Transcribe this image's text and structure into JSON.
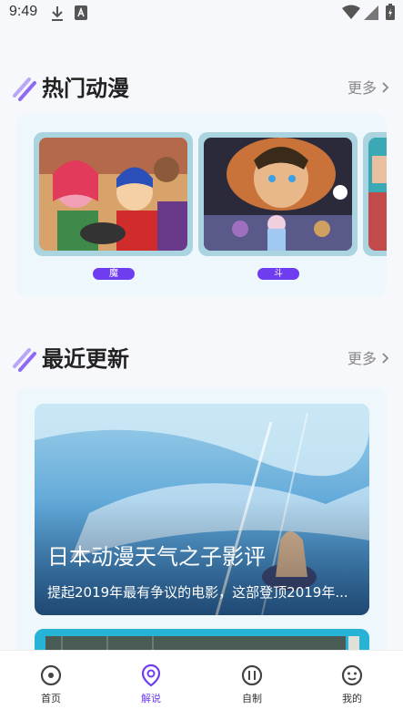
{
  "status_bar": {
    "time": "9:49",
    "icons": [
      "download-icon",
      "font-icon",
      "wifi-icon",
      "signal-icon",
      "battery-icon"
    ]
  },
  "hot_section": {
    "title": "热门动漫",
    "more_label": "更多",
    "cards": [
      {
        "image": "anime-poster-magic-kid",
        "label": "魔"
      },
      {
        "image": "anime-poster-fantasy-hero",
        "label": "斗"
      }
    ]
  },
  "recent_section": {
    "title": "最近更新",
    "more_label": "更多",
    "articles": [
      {
        "title": "日本动漫天气之子影评",
        "description": "提起2019年最有争议的电影，这部登顶2019年..."
      }
    ]
  },
  "tabbar": {
    "tabs": [
      {
        "label": "首页",
        "icon": "disc-icon"
      },
      {
        "label": "解说",
        "icon": "location-icon",
        "active": true
      },
      {
        "label": "自制",
        "icon": "sliders-icon"
      },
      {
        "label": "我的",
        "icon": "smile-icon"
      }
    ]
  },
  "colors": {
    "accent": "#6f3df0",
    "panel_bg": "#eef7fb",
    "card_frame": "#a9d4e0"
  }
}
